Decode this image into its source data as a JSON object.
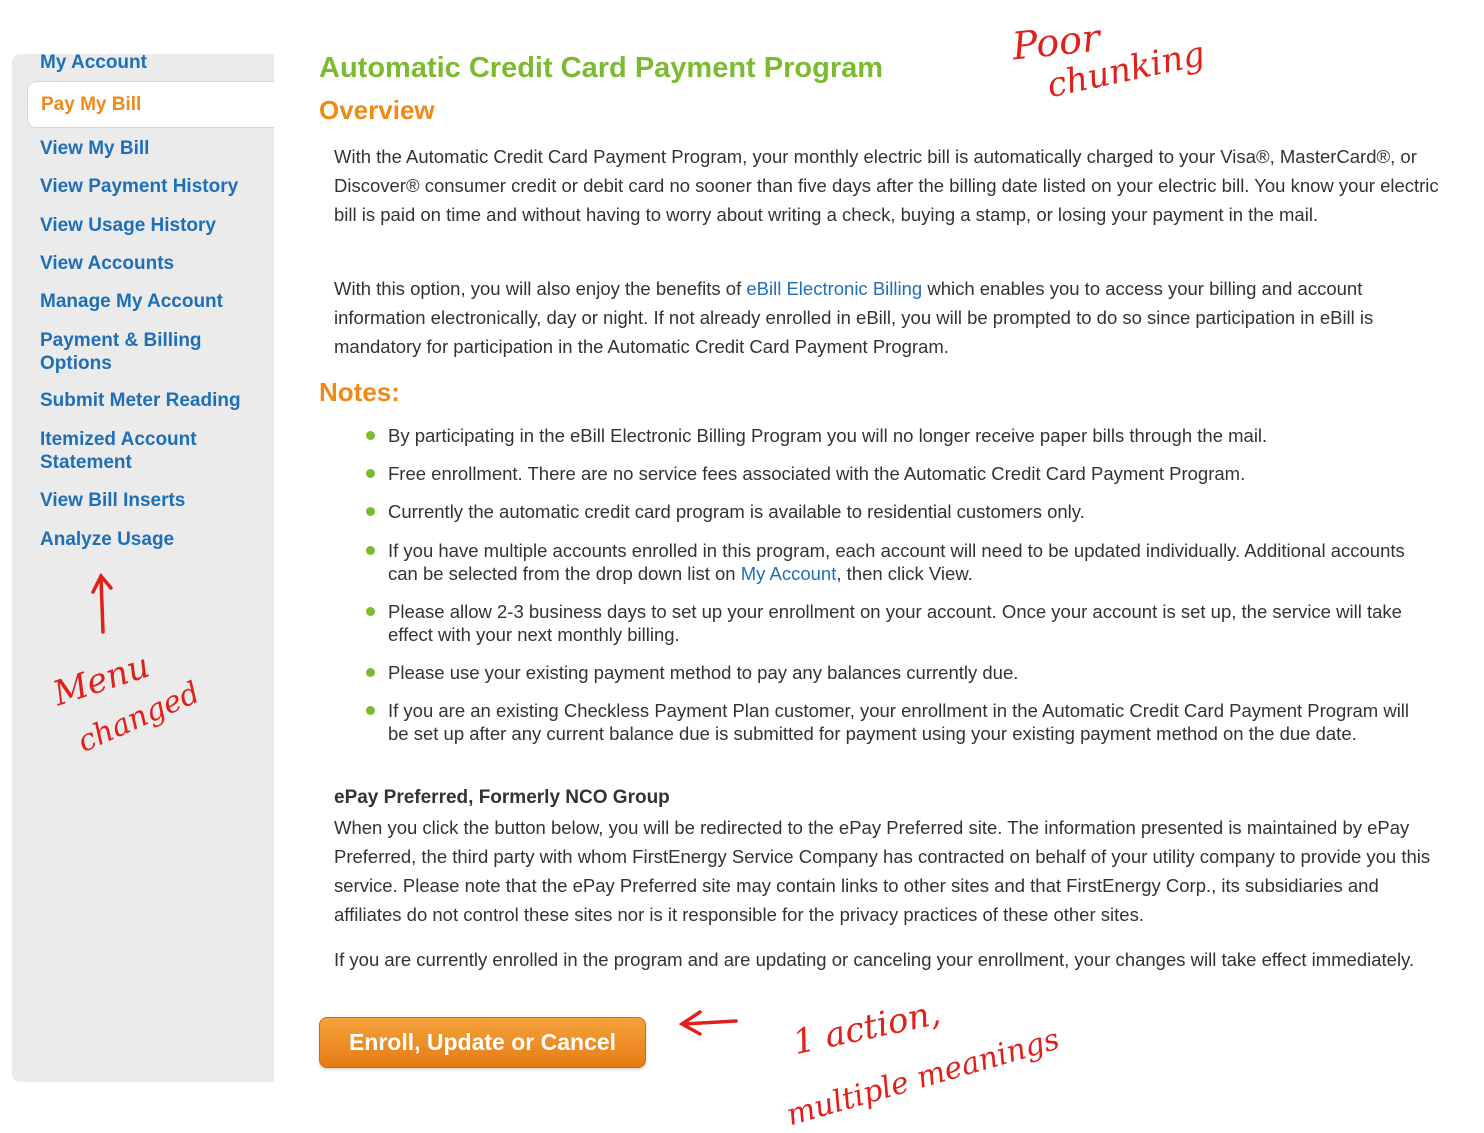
{
  "sidebar": {
    "items": [
      {
        "label": "My Account"
      },
      {
        "label": "Pay My Bill",
        "active": true
      },
      {
        "label": "View My Bill"
      },
      {
        "label": "View Payment History"
      },
      {
        "label": "View Usage History"
      },
      {
        "label": "View Accounts"
      },
      {
        "label": "Manage My Account"
      },
      {
        "label": "Payment & Billing Options"
      },
      {
        "label": "Submit Meter Reading"
      },
      {
        "label": "Itemized Account Statement"
      },
      {
        "label": "View Bill Inserts"
      },
      {
        "label": "Analyze Usage"
      }
    ]
  },
  "main": {
    "title": "Automatic Credit Card Payment Program",
    "overview_heading": "Overview",
    "intro_paragraph": "With the Automatic Credit Card Payment Program, your monthly electric bill is automatically charged to your Visa®, MasterCard®, or Discover® consumer credit or debit card no sooner than five days after the billing date listed on your electric bill.  You know your electric bill is paid on time and without having to worry about writing a check, buying a stamp, or losing your payment in the mail.",
    "ebill_paragraph": {
      "before": "With this option, you will also enjoy the benefits of ",
      "link": "eBill Electronic Billing",
      "after": " which enables you to access your billing and account information electronically, day or night. If not already enrolled in eBill, you will be prompted to do so since participation in eBill is mandatory for participation in the Automatic Credit Card Payment Program."
    },
    "notes_heading": "Notes:",
    "notes": [
      "By participating in the eBill Electronic Billing Program you will no longer receive paper bills through the mail.",
      "Free enrollment. There are no service fees associated with the Automatic Credit Card Payment Program.",
      "Currently the automatic credit card program is available to residential customers only.",
      {
        "before": "If you have multiple accounts enrolled in this program, each account will need to be updated individually.  Additional accounts can be selected from the drop down list on ",
        "link": "My Account",
        "after": ", then click View."
      },
      "Please allow 2-3 business days to set up your enrollment on your account. Once your account is set up, the service will take effect with your next monthly billing.",
      "Please use your existing payment method to pay any balances currently due.",
      "If you are an existing Checkless Payment Plan customer, your enrollment in the Automatic Credit Card Payment Program will be set up after any current balance due is submitted for payment using your existing payment method on the due date."
    ],
    "epay_heading": "ePay Preferred, Formerly NCO Group",
    "epay_paragraph": "When you click the button below, you will be redirected to the ePay Preferred site. The information presented is maintained by ePay Preferred, the third party with whom FirstEnergy Service Company has contracted on behalf of your utility company to provide you this service. Please note that the ePay Preferred site may contain links to other sites and that FirstEnergy Corp., its subsidiaries and affiliates do not control these sites nor is it responsible for the privacy practices of these other sites.",
    "enrolled_paragraph": "If you are currently enrolled in the program and are updating or canceling your enrollment, your changes will take effect immediately.",
    "cta_label": "Enroll, Update or Cancel"
  },
  "annotations": {
    "top_right": [
      "Poor",
      "chunking"
    ],
    "menu": [
      "Menu",
      "changed"
    ],
    "button": [
      "1 action,",
      "multiple meanings"
    ]
  },
  "colors": {
    "link_blue": "#1f6fb8",
    "title_green": "#7cbb2f",
    "heading_orange": "#ef8a17",
    "annotation_red": "#e0201a"
  }
}
